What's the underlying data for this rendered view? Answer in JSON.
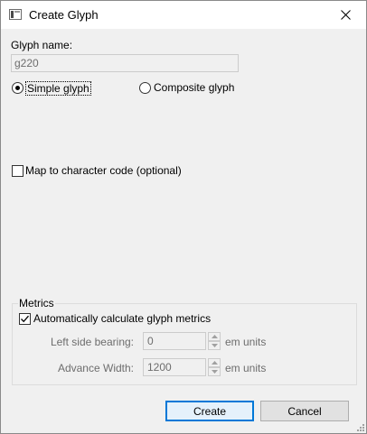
{
  "window": {
    "title": "Create Glyph",
    "app_icon": "glyph-editor-icon",
    "close_icon": "close-icon"
  },
  "glyph_name": {
    "label": "Glyph name:",
    "value": "g220"
  },
  "glyph_type": {
    "simple_label": "Simple glyph",
    "simple_selected": true,
    "composite_label": "Composite glyph",
    "composite_selected": false
  },
  "map_code": {
    "label": "Map to character code (optional)",
    "checked": false
  },
  "metrics": {
    "group_title": "Metrics",
    "auto_label": "Automatically calculate glyph metrics",
    "auto_checked": true,
    "lsb_label": "Left side bearing:",
    "lsb_value": "0",
    "aw_label": "Advance Width:",
    "aw_value": "1200",
    "units": "em units",
    "spin_up_icon": "arrow-up-icon",
    "spin_down_icon": "arrow-down-icon"
  },
  "buttons": {
    "create": "Create",
    "cancel": "Cancel"
  },
  "colors": {
    "accent": "#0078d7",
    "disabled_text": "#6d6d6d",
    "dialog_bg": "#f0f0f0"
  }
}
